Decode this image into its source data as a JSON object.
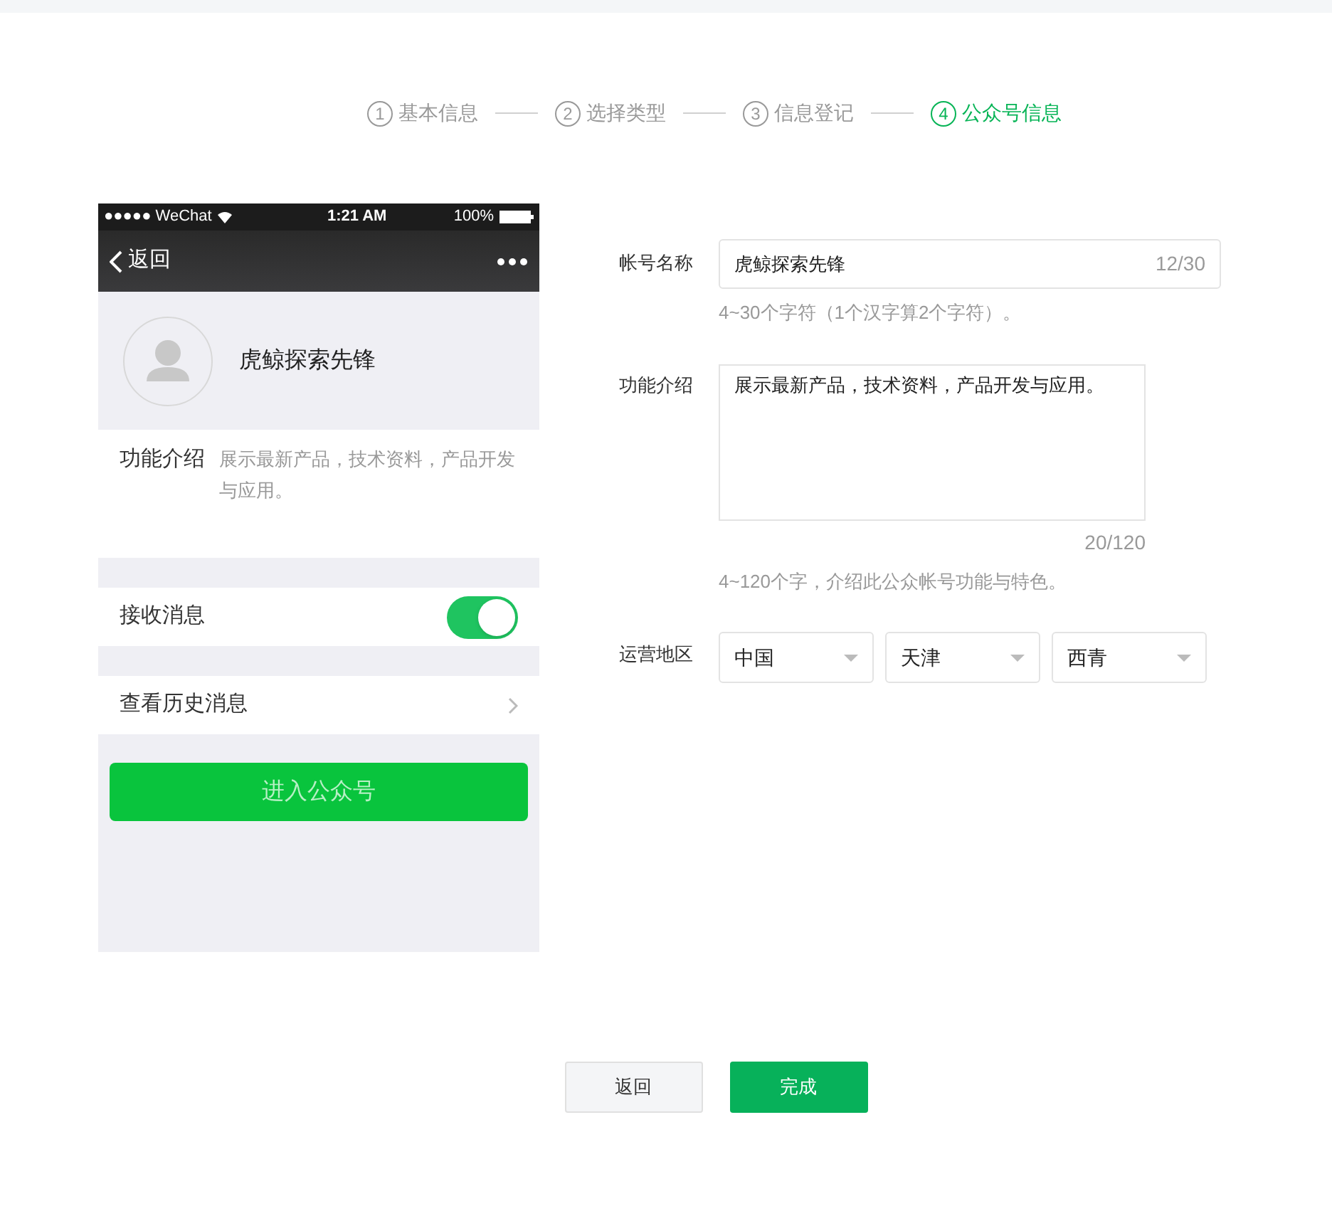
{
  "steps": [
    {
      "number": "1",
      "label": "基本信息",
      "selected": false
    },
    {
      "number": "2",
      "label": "选择类型",
      "selected": false
    },
    {
      "number": "3",
      "label": "信息登记",
      "selected": false
    },
    {
      "number": "4",
      "label": "公众号信息",
      "selected": true
    }
  ],
  "preview": {
    "status_bar": {
      "carrier": "●●●●● WeChat",
      "time": "1:21 AM",
      "battery": "100%"
    },
    "back": "返回",
    "account_name": "虎鲸探索先锋",
    "intro_label": "功能介绍",
    "intro_text": "展示最新产品，技术资料，产品开发与应用。",
    "receive_label": "接收消息",
    "receive_on": true,
    "history_label": "查看历史消息",
    "enter_button": "进入公众号"
  },
  "form": {
    "name_label": "帐号名称",
    "name_value": "虎鲸探索先锋",
    "name_count": "12/30",
    "name_hint": "4~30个字符（1个汉字算2个字符）。",
    "intro_label": "功能介绍",
    "intro_value": "展示最新产品，技术资料，产品开发与应用。",
    "intro_count": "20/120",
    "intro_hint": "4~120个字，介绍此公众帐号功能与特色。",
    "region_label": "运营地区",
    "regions": [
      "中国",
      "天津",
      "西青"
    ]
  },
  "buttons": {
    "back": "返回",
    "done": "完成"
  }
}
